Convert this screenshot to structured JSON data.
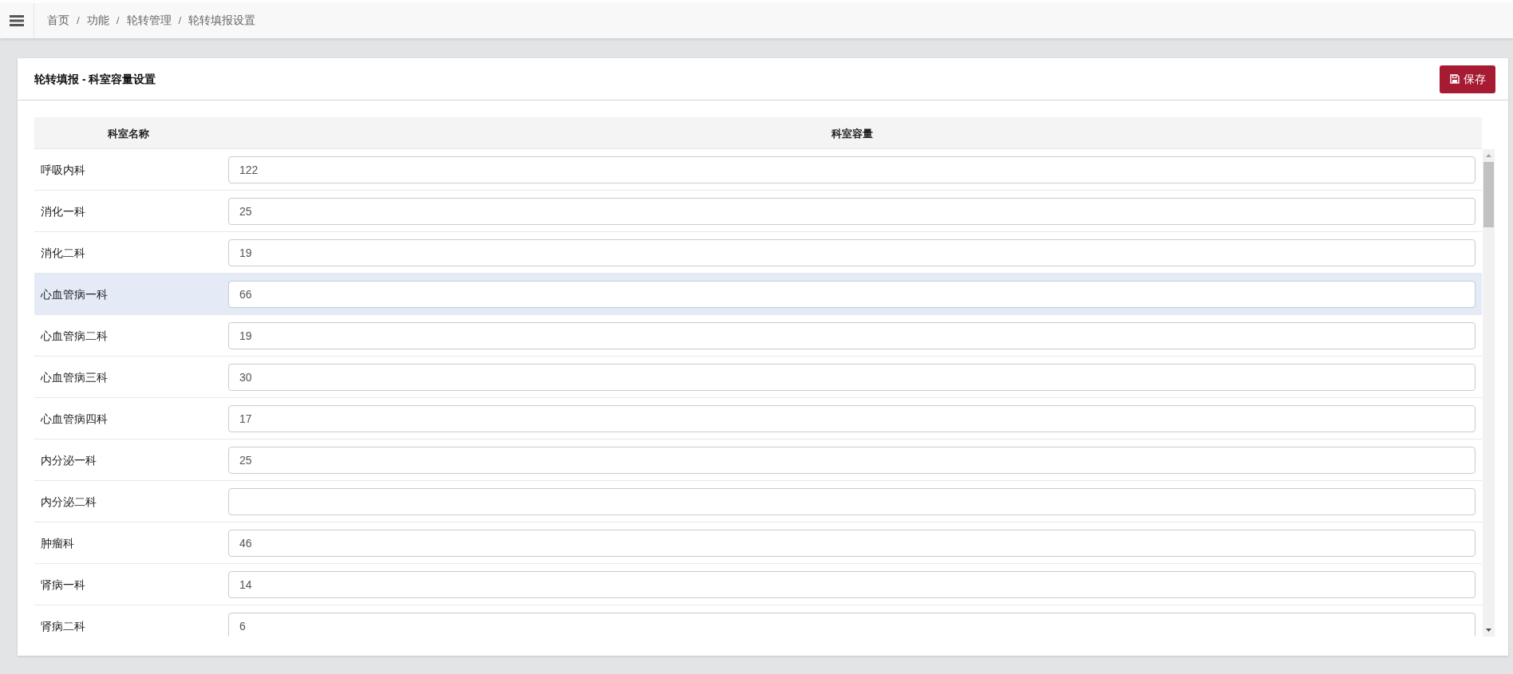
{
  "breadcrumb": [
    {
      "label": "首页"
    },
    {
      "separator": "/",
      "label": "功能"
    },
    {
      "separator": "/",
      "label": "轮转管理"
    },
    {
      "separator": "/",
      "label": "轮转填报设置"
    }
  ],
  "panel": {
    "title": "轮转填报 - 科室容量设置",
    "save_button": {
      "label": "保存"
    }
  },
  "table": {
    "columns": [
      {
        "label": "科室名称"
      },
      {
        "label": "科室容量"
      }
    ],
    "rows": [
      {
        "name": "呼吸内科",
        "capacity": "122",
        "selected": false
      },
      {
        "name": "消化一科",
        "capacity": "25",
        "selected": false
      },
      {
        "name": "消化二科",
        "capacity": "19",
        "selected": false
      },
      {
        "name": "心血管病一科",
        "capacity": "66",
        "selected": true
      },
      {
        "name": "心血管病二科",
        "capacity": "19",
        "selected": false
      },
      {
        "name": "心血管病三科",
        "capacity": "30",
        "selected": false
      },
      {
        "name": "心血管病四科",
        "capacity": "17",
        "selected": false
      },
      {
        "name": "内分泌一科",
        "capacity": "25",
        "selected": false
      },
      {
        "name": "内分泌二科",
        "selected": false
      },
      {
        "name": "肿瘤科",
        "capacity": "46",
        "selected": false
      },
      {
        "name": "肾病一科",
        "capacity": "14",
        "selected": false
      },
      {
        "name": "肾病二科",
        "capacity": "6",
        "selected": false
      }
    ]
  }
}
